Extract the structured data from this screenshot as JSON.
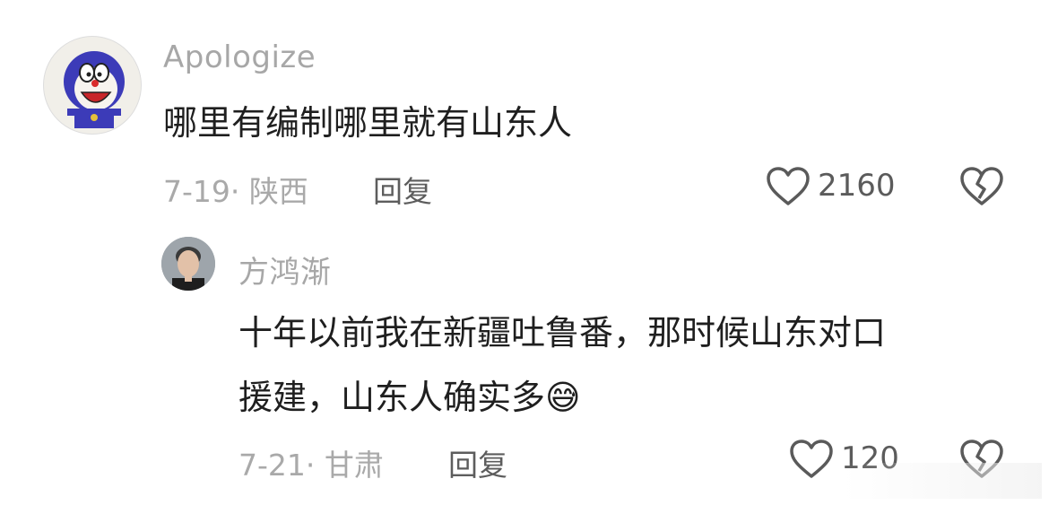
{
  "comments": [
    {
      "username": "Apologize",
      "text": "哪里有编制哪里就有山东人",
      "date": "7-19",
      "separator": "·",
      "location": "陕西",
      "reply_label": "回复",
      "like_count": "2160"
    }
  ],
  "reply": {
    "username": "方鸿渐",
    "text_line1": "十年以前我在新疆吐鲁番，那时候山东对口",
    "text_line2": "援建，山东人确实多",
    "emoji": "😅",
    "date": "7-21",
    "separator": "·",
    "location": "甘肃",
    "reply_label": "回复",
    "like_count": "120"
  },
  "icons": {
    "like": "heart-outline-icon",
    "dislike": "broken-heart-outline-icon"
  },
  "colors": {
    "username": "#a7a7a7",
    "text": "#1f1f1f",
    "meta": "#a9a9a9",
    "reply": "#5d5d5d"
  }
}
